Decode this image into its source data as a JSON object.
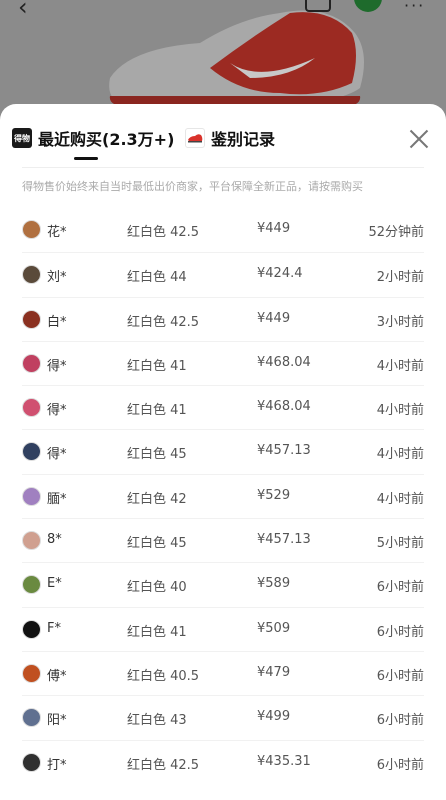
{
  "tabs": [
    {
      "label": "最近购买(2.3万+)",
      "icon": "dewu-logo-icon",
      "active": true
    },
    {
      "label": "鉴别记录",
      "icon": "sneaker-thumb-icon",
      "active": false
    }
  ],
  "notice": "得物售价始终来自当时最低出价商家，平台保障全新正品，请按需购买",
  "purchases": [
    {
      "name": "花*",
      "spec": "红白色 42.5",
      "price": "¥449",
      "time": "52分钟前",
      "avatar_color": "#b07040"
    },
    {
      "name": "刘*",
      "spec": "红白色 44",
      "price": "¥424.4",
      "time": "2小时前",
      "avatar_color": "#5a4a3a"
    },
    {
      "name": "白*",
      "spec": "红白色 42.5",
      "price": "¥449",
      "time": "3小时前",
      "avatar_color": "#8a3020"
    },
    {
      "name": "得*",
      "spec": "红白色 41",
      "price": "¥468.04",
      "time": "4小时前",
      "avatar_color": "#c04060"
    },
    {
      "name": "得*",
      "spec": "红白色 41",
      "price": "¥468.04",
      "time": "4小时前",
      "avatar_color": "#d05070"
    },
    {
      "name": "得*",
      "spec": "红白色 45",
      "price": "¥457.13",
      "time": "4小时前",
      "avatar_color": "#304060"
    },
    {
      "name": "腼*",
      "spec": "红白色 42",
      "price": "¥529",
      "time": "4小时前",
      "avatar_color": "#a080c0"
    },
    {
      "name": "8*",
      "spec": "红白色 45",
      "price": "¥457.13",
      "time": "5小时前",
      "avatar_color": "#d0a090"
    },
    {
      "name": "E*",
      "spec": "红白色 40",
      "price": "¥589",
      "time": "6小时前",
      "avatar_color": "#6a8a40"
    },
    {
      "name": "F*",
      "spec": "红白色 41",
      "price": "¥509",
      "time": "6小时前",
      "avatar_color": "#111111"
    },
    {
      "name": "傅*",
      "spec": "红白色 40.5",
      "price": "¥479",
      "time": "6小时前",
      "avatar_color": "#c05020"
    },
    {
      "name": "阳*",
      "spec": "红白色 43",
      "price": "¥499",
      "time": "6小时前",
      "avatar_color": "#607090"
    },
    {
      "name": "打*",
      "spec": "红白色 42.5",
      "price": "¥435.31",
      "time": "6小时前",
      "avatar_color": "#303030"
    }
  ],
  "colors": {
    "overlay": "#8b8b8b",
    "shoe_red": "#d9322b"
  }
}
